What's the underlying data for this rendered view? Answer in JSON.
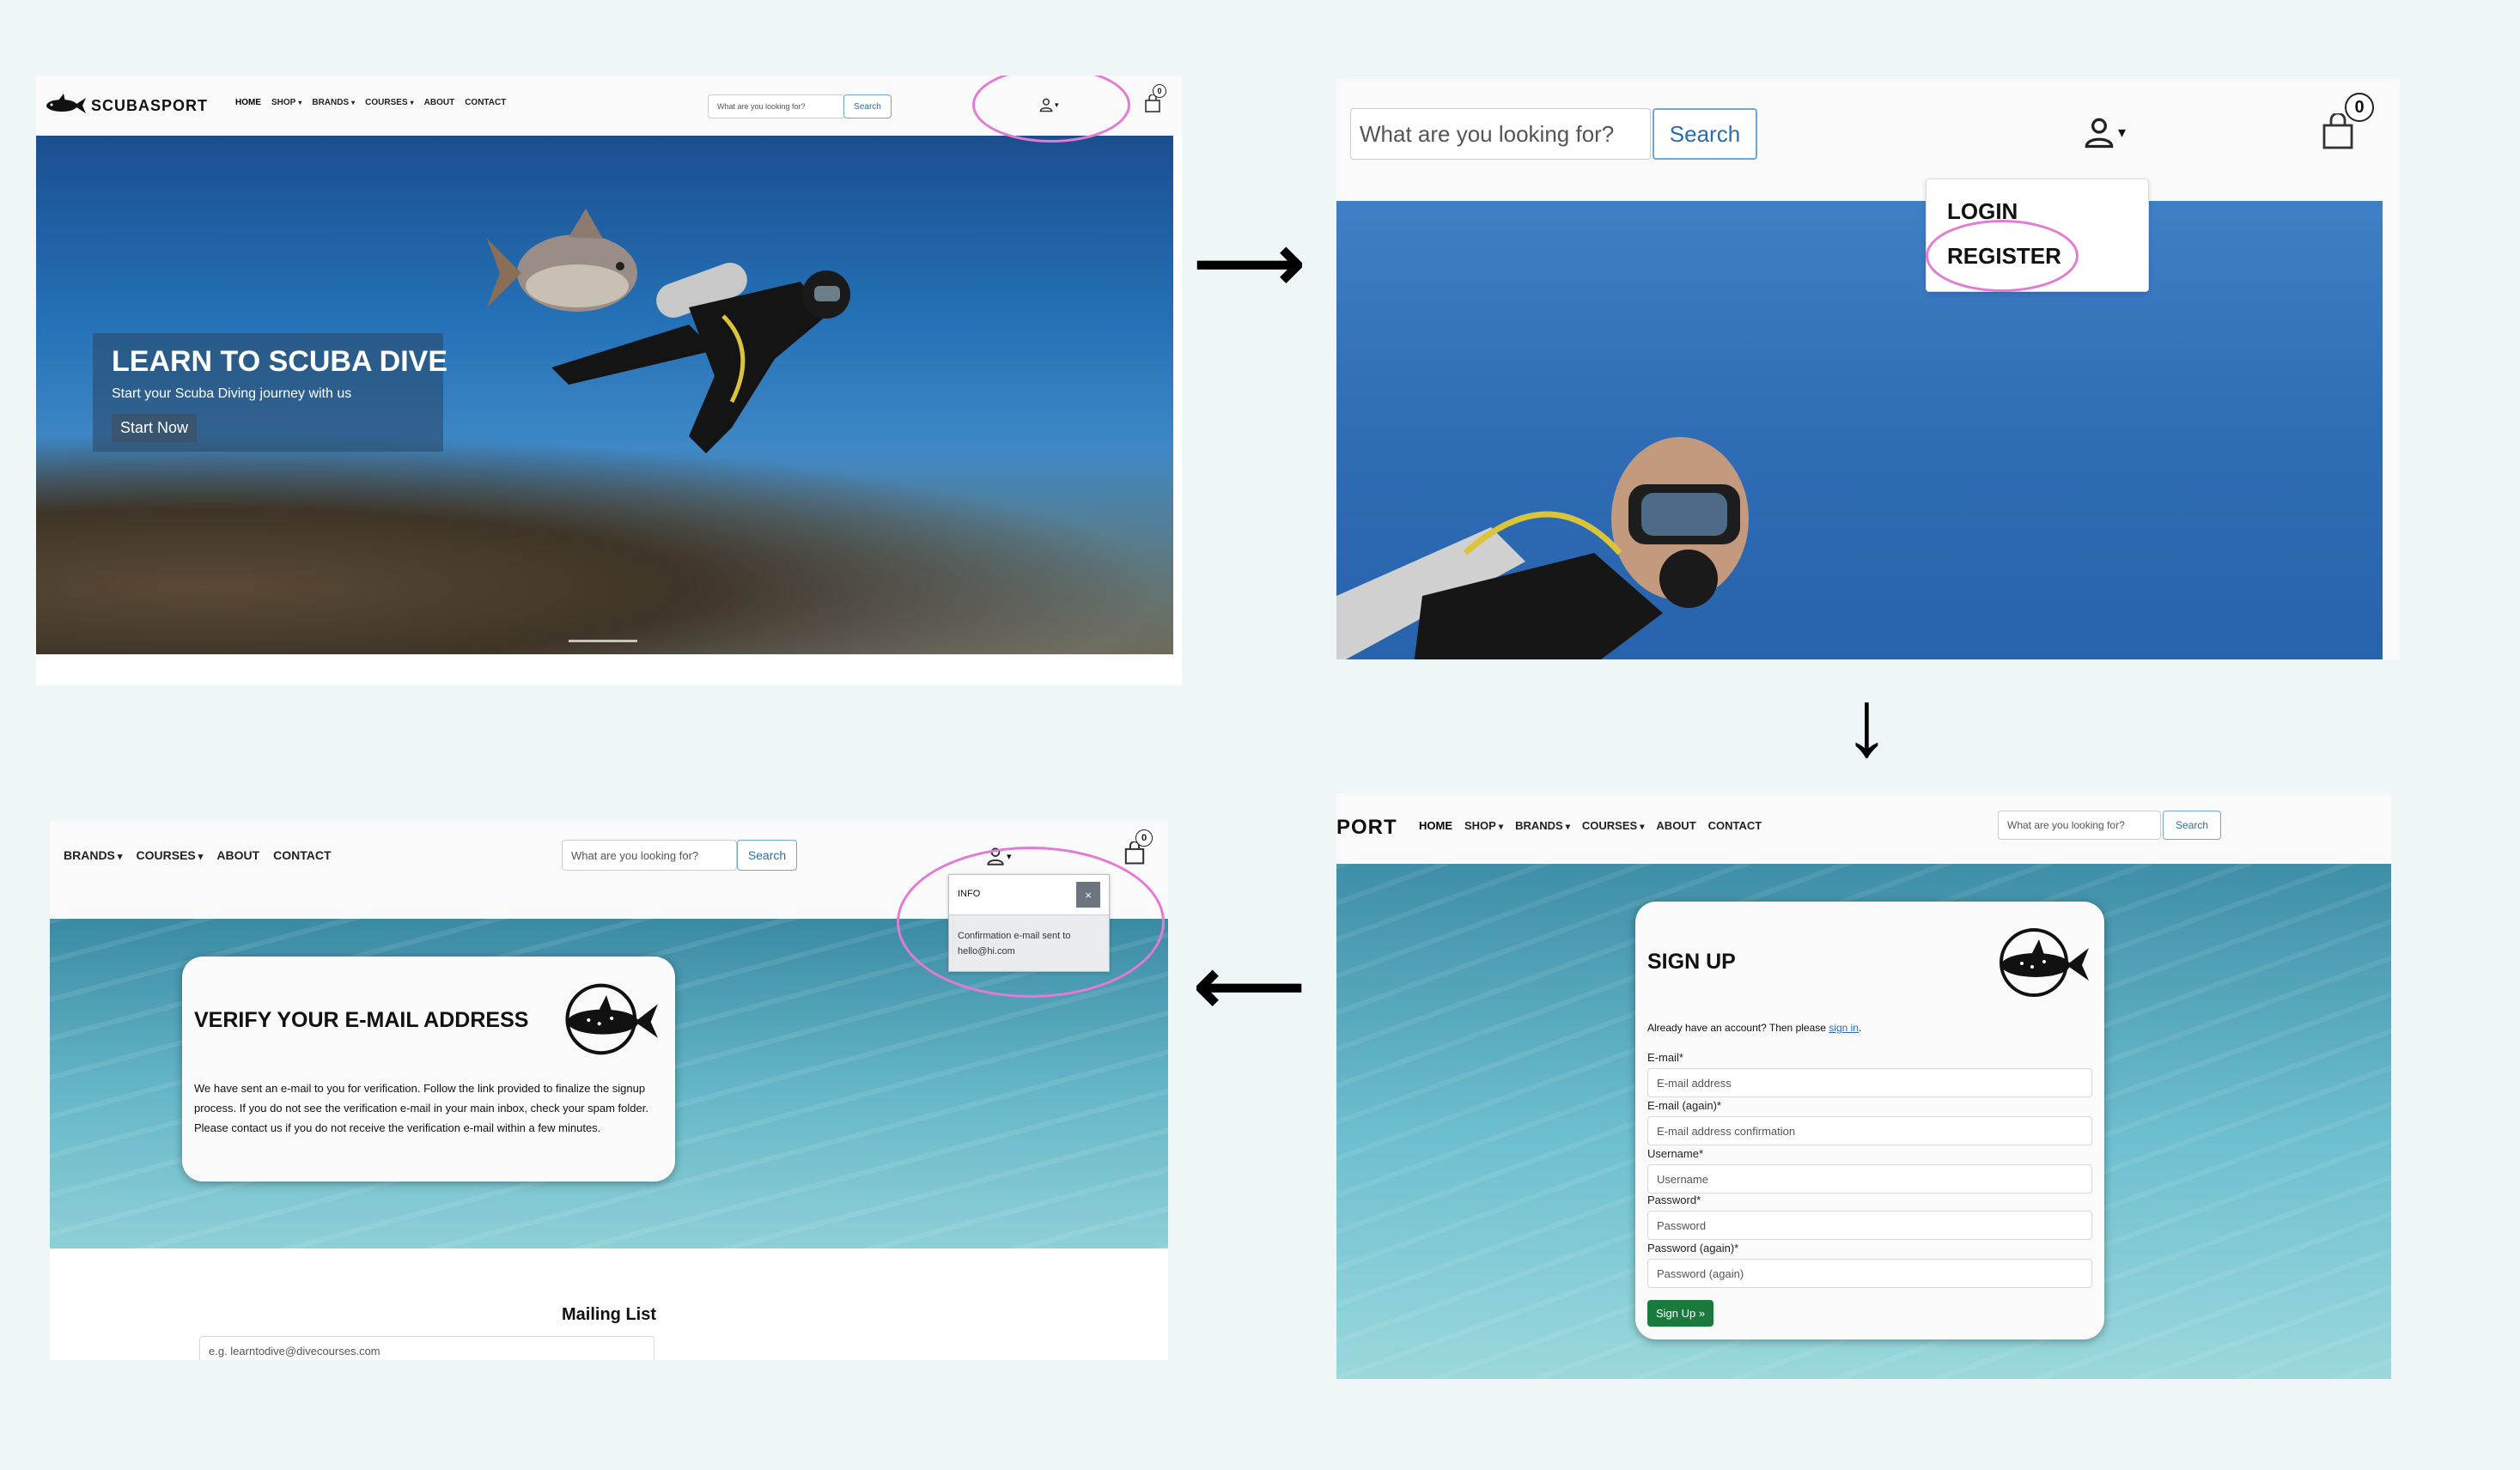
{
  "nav": {
    "brand": "SCUBASPORT",
    "brand_partial": "PORT",
    "home": "HOME",
    "shop": "SHOP",
    "brands": "BRANDS",
    "courses": "COURSES",
    "about": "ABOUT",
    "contact": "CONTACT",
    "search_placeholder": "What are you looking for?",
    "search_button": "Search",
    "cart_count": "0"
  },
  "hero": {
    "title": "LEARN TO SCUBA DIVE",
    "subtitle": "Start your Scuba Diving journey with us",
    "cta": "Start Now"
  },
  "dropdown": {
    "login": "LOGIN",
    "register": "REGISTER"
  },
  "signup": {
    "title": "SIGN UP",
    "intro": "Already have an account? Then please",
    "signin_link": "sign in",
    "intro_end": ".",
    "email_label": "E-mail*",
    "email_placeholder": "E-mail address",
    "email2_label": "E-mail (again)*",
    "email2_placeholder": "E-mail address confirmation",
    "username_label": "Username*",
    "username_placeholder": "Username",
    "password_label": "Password*",
    "password_placeholder": "Password",
    "password2_label": "Password (again)*",
    "password2_placeholder": "Password (again)",
    "submit": "Sign Up »"
  },
  "verify": {
    "title": "VERIFY YOUR E-MAIL ADDRESS",
    "body": "We have sent an e-mail to you for verification. Follow the link provided to finalize the signup process. If you do not see the verification e-mail in your main inbox, check your spam folder. Please contact us if you do not receive the verification e-mail within a few minutes.",
    "toast_title": "INFO",
    "toast_close": "×",
    "toast_body": "Confirmation e-mail sent to hello@hi.com",
    "mailing_title": "Mailing List",
    "mailing_placeholder": "e.g. learntodive@divecourses.com"
  },
  "arrows": {
    "right": "⟶",
    "down": "↓",
    "left": "⟵"
  },
  "colors": {
    "highlight": "#e37ad3",
    "ocean": "#1f63a8",
    "sign_up_button": "#1a7a3e",
    "search_border": "#6ea8d6"
  }
}
